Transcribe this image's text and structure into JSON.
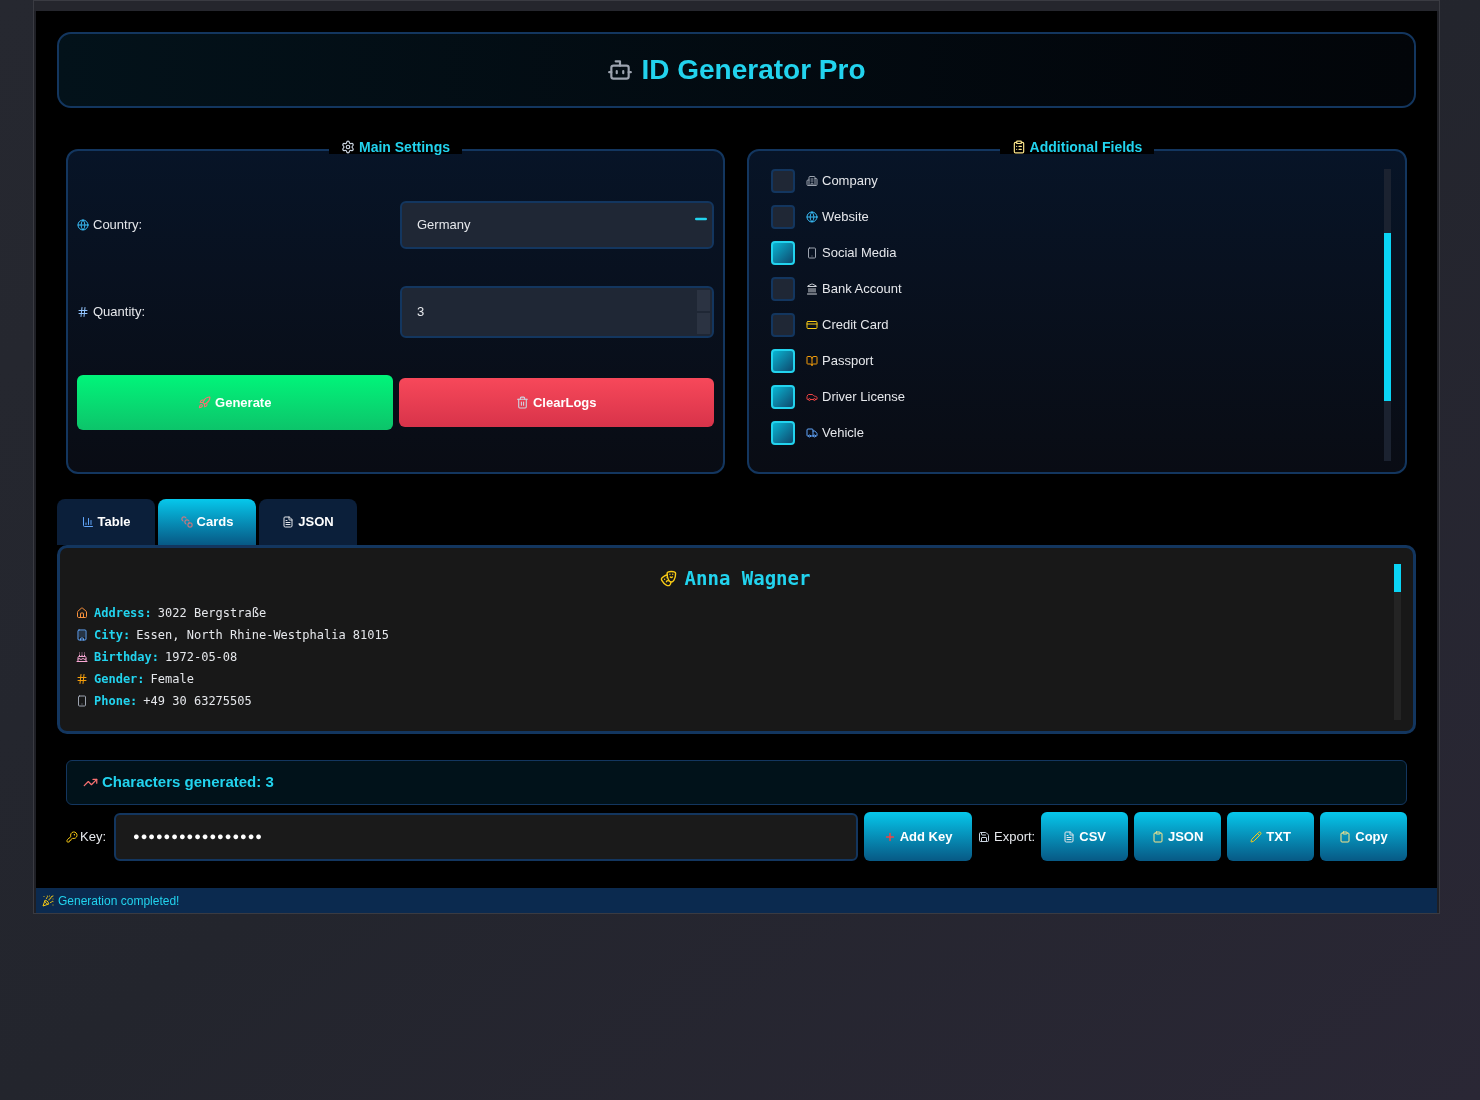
{
  "header": {
    "title": "ID Generator Pro"
  },
  "main_settings": {
    "title": "Main Settings",
    "country": {
      "label": "Country:",
      "value": "Germany"
    },
    "quantity": {
      "label": "Quantity:",
      "value": "3"
    },
    "buttons": [
      {
        "kind": "generate",
        "label": "Generate"
      },
      {
        "kind": "clear",
        "label": "ClearLogs"
      }
    ]
  },
  "additional_fields": {
    "title": "Additional Fields",
    "items": [
      {
        "label": "Company",
        "checked": false
      },
      {
        "label": "Website",
        "checked": false
      },
      {
        "label": "Social Media",
        "checked": true
      },
      {
        "label": "Bank Account",
        "checked": false
      },
      {
        "label": "Credit Card",
        "checked": false
      },
      {
        "label": "Passport",
        "checked": true
      },
      {
        "label": "Driver License",
        "checked": true
      },
      {
        "label": "Vehicle",
        "checked": true
      }
    ]
  },
  "tabs": [
    {
      "label": "Table",
      "selected": false
    },
    {
      "label": "Cards",
      "selected": true
    },
    {
      "label": "JSON",
      "selected": false
    }
  ],
  "card": {
    "name": "Anna Wagner",
    "fields": [
      {
        "label": "Address:",
        "value": "3022 Bergstraße"
      },
      {
        "label": "City:",
        "value": "Essen, North Rhine-Westphalia 81015"
      },
      {
        "label": "Birthday:",
        "value": "1972-05-08"
      },
      {
        "label": "Gender:",
        "value": "Female"
      },
      {
        "label": "Phone:",
        "value": "+49 30 63275505"
      }
    ]
  },
  "stats": {
    "text": "Characters generated: 3"
  },
  "key": {
    "label": "Key:",
    "value": "●●●●●●●●●●●●●●●●●",
    "button": "Add Key"
  },
  "export": {
    "label": "Export:",
    "buttons": [
      {
        "label": "CSV"
      },
      {
        "label": "JSON"
      },
      {
        "label": "TXT"
      },
      {
        "label": "Copy"
      }
    ]
  },
  "status_bar": {
    "text": "Generation completed!"
  }
}
